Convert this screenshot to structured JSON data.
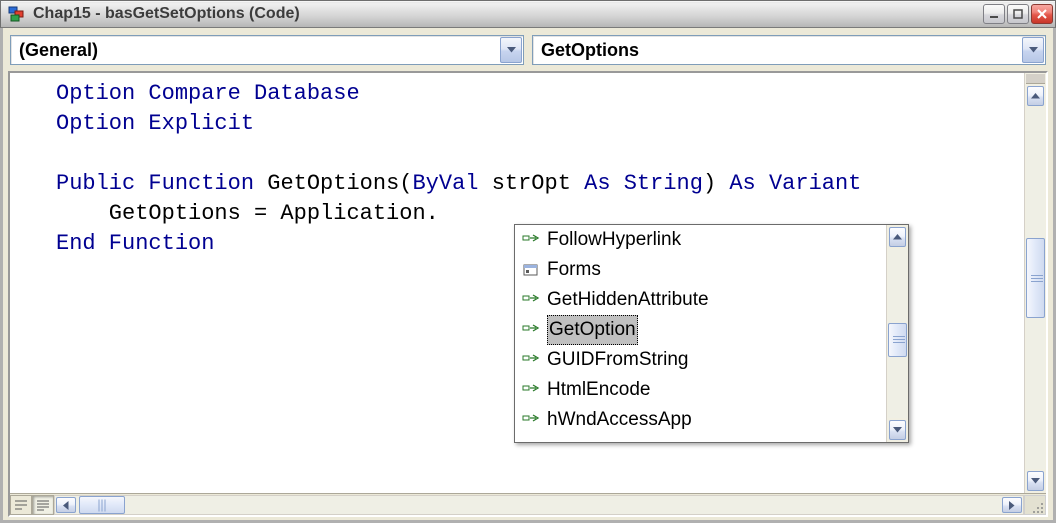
{
  "window": {
    "title": "Chap15 - basGetSetOptions (Code)"
  },
  "dropdowns": {
    "object": "(General)",
    "procedure": "GetOptions"
  },
  "code": {
    "l1_a": "Option Compare Database",
    "l2_a": "Option Explicit",
    "l3_a": "",
    "l4_a": "Public",
    "l4_b": " ",
    "l4_c": "Function",
    "l4_d": " GetOptions(",
    "l4_e": "ByVal",
    "l4_f": " strOpt ",
    "l4_g": "As",
    "l4_h": " ",
    "l4_i": "String",
    "l4_j": ") ",
    "l4_k": "As",
    "l4_l": " ",
    "l4_m": "Variant",
    "l5_a": "    GetOptions = Application.",
    "l6_a": "End Function"
  },
  "popup": {
    "items": [
      {
        "icon": "method",
        "label": "FollowHyperlink"
      },
      {
        "icon": "object",
        "label": "Forms"
      },
      {
        "icon": "method",
        "label": "GetHiddenAttribute"
      },
      {
        "icon": "method",
        "label": "GetOption"
      },
      {
        "icon": "method",
        "label": "GUIDFromString"
      },
      {
        "icon": "method",
        "label": "HtmlEncode"
      },
      {
        "icon": "method",
        "label": "hWndAccessApp"
      }
    ],
    "selected_index": 3
  },
  "colors": {
    "keyword": "#000091"
  }
}
